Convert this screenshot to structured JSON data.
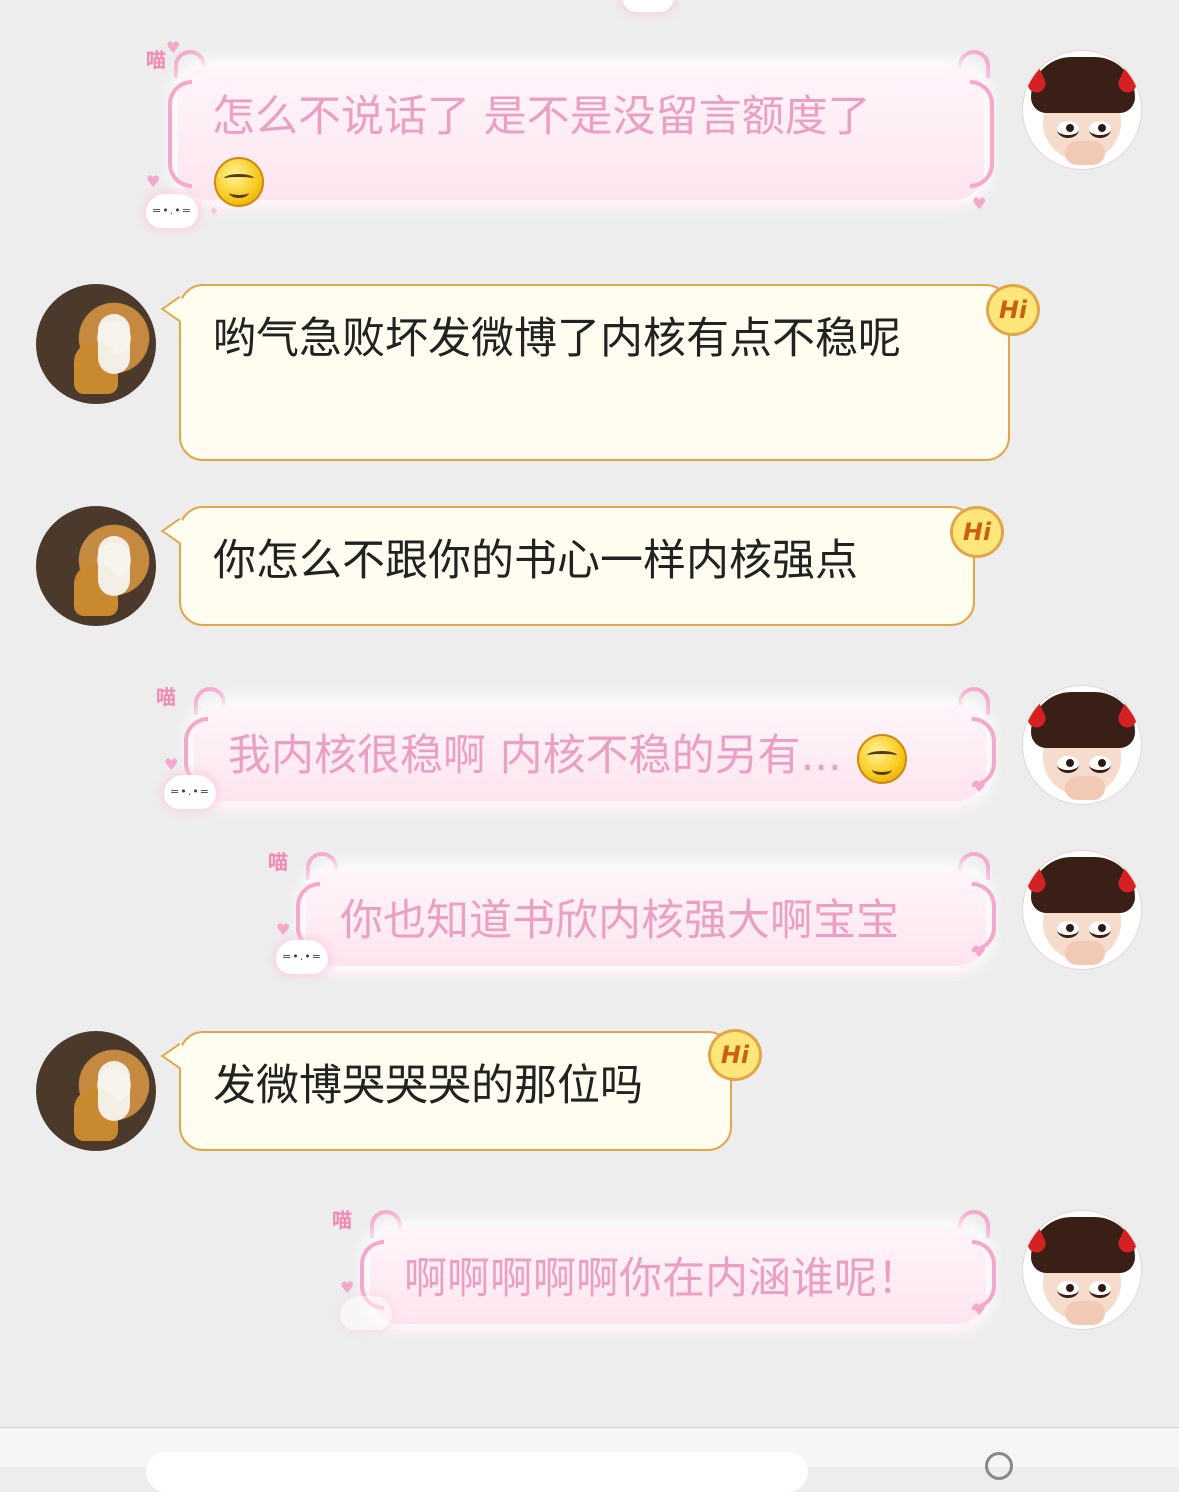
{
  "messages": [
    {
      "side": "self",
      "text": "怎么不说话了 是不是没留言额度了",
      "emoji": "smirk-emoji"
    },
    {
      "side": "friend",
      "text": "哟气急败坏发微博了内核有点不稳呢",
      "badge": "Hi"
    },
    {
      "side": "friend",
      "text": "你怎么不跟你的书心一样内核强点",
      "badge": "Hi"
    },
    {
      "side": "self",
      "text": "我内核很稳啊 内核不稳的另有...",
      "emoji": "smirk-emoji"
    },
    {
      "side": "self",
      "text": "你也知道书欣内核强大啊宝宝"
    },
    {
      "side": "friend",
      "text": "发微博哭哭哭的那位吗",
      "badge": "Hi"
    },
    {
      "side": "self",
      "text": "啊啊啊啊啊你在内涵谁呢！"
    }
  ],
  "bubble_deco": {
    "label": "喵",
    "cat_face": "=•.•="
  },
  "colors": {
    "background": "#ededed",
    "friend_bubble": "#fffdf0",
    "friend_border": "#e2a64a",
    "self_text": "#eaa0c4",
    "self_bracket": "#f4a8cb"
  }
}
